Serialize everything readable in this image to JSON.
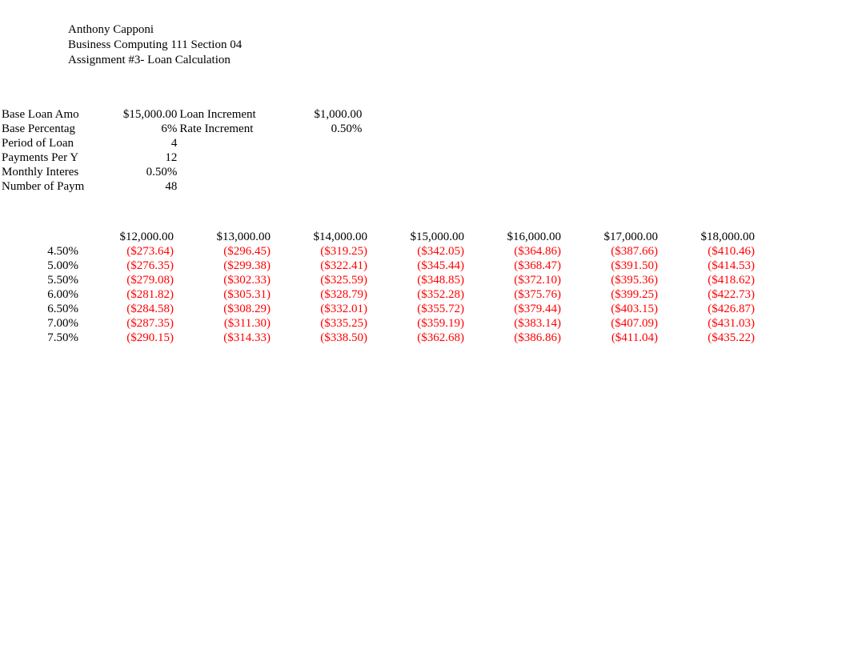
{
  "header": {
    "line1": "Anthony Capponi",
    "line2": "Business Computing 111 Section 04",
    "line3": "Assignment #3- Loan Calculation"
  },
  "params": {
    "base_loan_label": "Base Loan Amo",
    "base_loan_value": "$15,000.00",
    "loan_increment_label": "Loan Increment",
    "loan_increment_value": "$1,000.00",
    "base_pct_label": "Base Percentag",
    "base_pct_value": "6%",
    "rate_increment_label": "Rate Increment",
    "rate_increment_value": "0.50%",
    "period_label": "Period of Loan",
    "period_value": "4",
    "payments_per_y_label": "Payments Per Y",
    "payments_per_y_value": "12",
    "monthly_interest_label": "Monthly Interes",
    "monthly_interest_value": "0.50%",
    "num_payments_label": "Number of Paym",
    "num_payments_value": "48"
  },
  "chart_data": {
    "type": "table",
    "title": "Monthly loan payment by principal and annual rate",
    "loan_amounts": [
      "$12,000.00",
      "$13,000.00",
      "$14,000.00",
      "$15,000.00",
      "$16,000.00",
      "$17,000.00",
      "$18,000.00"
    ],
    "rates": [
      "4.50%",
      "5.00%",
      "5.50%",
      "6.00%",
      "6.50%",
      "7.00%",
      "7.50%"
    ],
    "payments": [
      [
        "($273.64)",
        "($296.45)",
        "($319.25)",
        "($342.05)",
        "($364.86)",
        "($387.66)",
        "($410.46)"
      ],
      [
        "($276.35)",
        "($299.38)",
        "($322.41)",
        "($345.44)",
        "($368.47)",
        "($391.50)",
        "($414.53)"
      ],
      [
        "($279.08)",
        "($302.33)",
        "($325.59)",
        "($348.85)",
        "($372.10)",
        "($395.36)",
        "($418.62)"
      ],
      [
        "($281.82)",
        "($305.31)",
        "($328.79)",
        "($352.28)",
        "($375.76)",
        "($399.25)",
        "($422.73)"
      ],
      [
        "($284.58)",
        "($308.29)",
        "($332.01)",
        "($355.72)",
        "($379.44)",
        "($403.15)",
        "($426.87)"
      ],
      [
        "($287.35)",
        "($311.30)",
        "($335.25)",
        "($359.19)",
        "($383.14)",
        "($407.09)",
        "($431.03)"
      ],
      [
        "($290.15)",
        "($314.33)",
        "($338.50)",
        "($362.68)",
        "($386.86)",
        "($411.04)",
        "($435.22)"
      ]
    ]
  }
}
